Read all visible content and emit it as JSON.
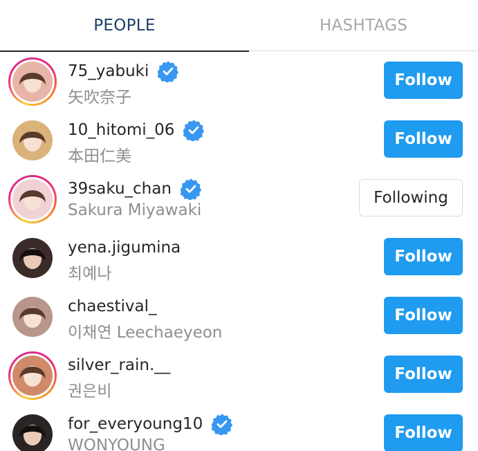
{
  "tabs": {
    "people": "PEOPLE",
    "hashtags": "HASHTAGS"
  },
  "colors": {
    "accent": "#1f9bf0",
    "active_tab": "#1c3f69",
    "inactive_tab": "#a8a8a8",
    "secondary_text": "#8e8e8e"
  },
  "users": [
    {
      "username": "75_yabuki",
      "fullname": "矢吹奈子",
      "verified": true,
      "story_ring": true,
      "button": "Follow",
      "avatar_color": "#e8b4a8"
    },
    {
      "username": "10_hitomi_06",
      "fullname": "本田仁美",
      "verified": true,
      "story_ring": false,
      "button": "Follow",
      "avatar_color": "#d9b37a"
    },
    {
      "username": "39saku_chan",
      "fullname": "Sakura Miyawaki",
      "verified": true,
      "story_ring": true,
      "button": "Following",
      "avatar_color": "#f0d2d6"
    },
    {
      "username": "yena.jigumina",
      "fullname": "최예나",
      "verified": false,
      "story_ring": false,
      "button": "Follow",
      "avatar_color": "#3a2b28"
    },
    {
      "username": "chaestival_",
      "fullname": "이채연 Leechaeyeon",
      "verified": false,
      "story_ring": false,
      "button": "Follow",
      "avatar_color": "#b8968a"
    },
    {
      "username": "silver_rain.__",
      "fullname": "권은비",
      "verified": false,
      "story_ring": true,
      "button": "Follow",
      "avatar_color": "#d08a6a"
    },
    {
      "username": "for_everyoung10",
      "fullname": "WONYOUNG",
      "verified": true,
      "story_ring": false,
      "button": "Follow",
      "avatar_color": "#2a2424"
    }
  ]
}
